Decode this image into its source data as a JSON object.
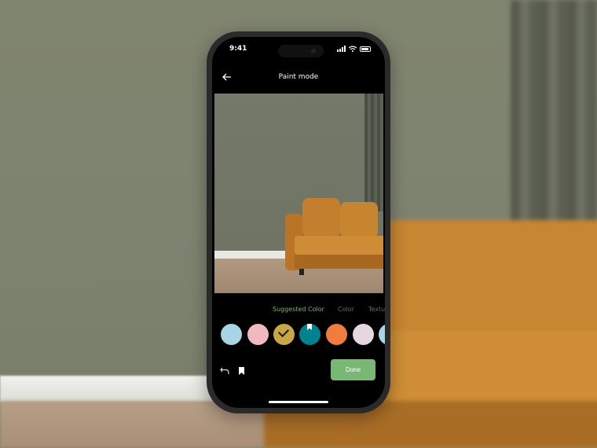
{
  "status": {
    "time": "9:41"
  },
  "nav": {
    "title": "Paint mode",
    "back_icon": "arrow-left-icon"
  },
  "tabs": {
    "items": [
      {
        "label": "Suggested Color",
        "active": true
      },
      {
        "label": "Color",
        "active": false
      },
      {
        "label": "Texture",
        "active": false
      }
    ]
  },
  "swatches": [
    {
      "color": "#a9d4e6",
      "selected": false
    },
    {
      "color": "#f2b8c0",
      "selected": false
    },
    {
      "color": "#c9a646",
      "selected": true
    },
    {
      "color": "#00838f",
      "selected": false,
      "bookmarked": true
    },
    {
      "color": "#f07c40",
      "selected": false
    },
    {
      "color": "#e6d6e0",
      "selected": false
    },
    {
      "color": "#a9d4e6",
      "selected": false
    }
  ],
  "actions": {
    "undo_icon": "undo-icon",
    "bookmark_icon": "bookmark-icon",
    "done_label": "Done"
  },
  "colors": {
    "accent": "#79b774",
    "screen_bg": "#000000"
  }
}
